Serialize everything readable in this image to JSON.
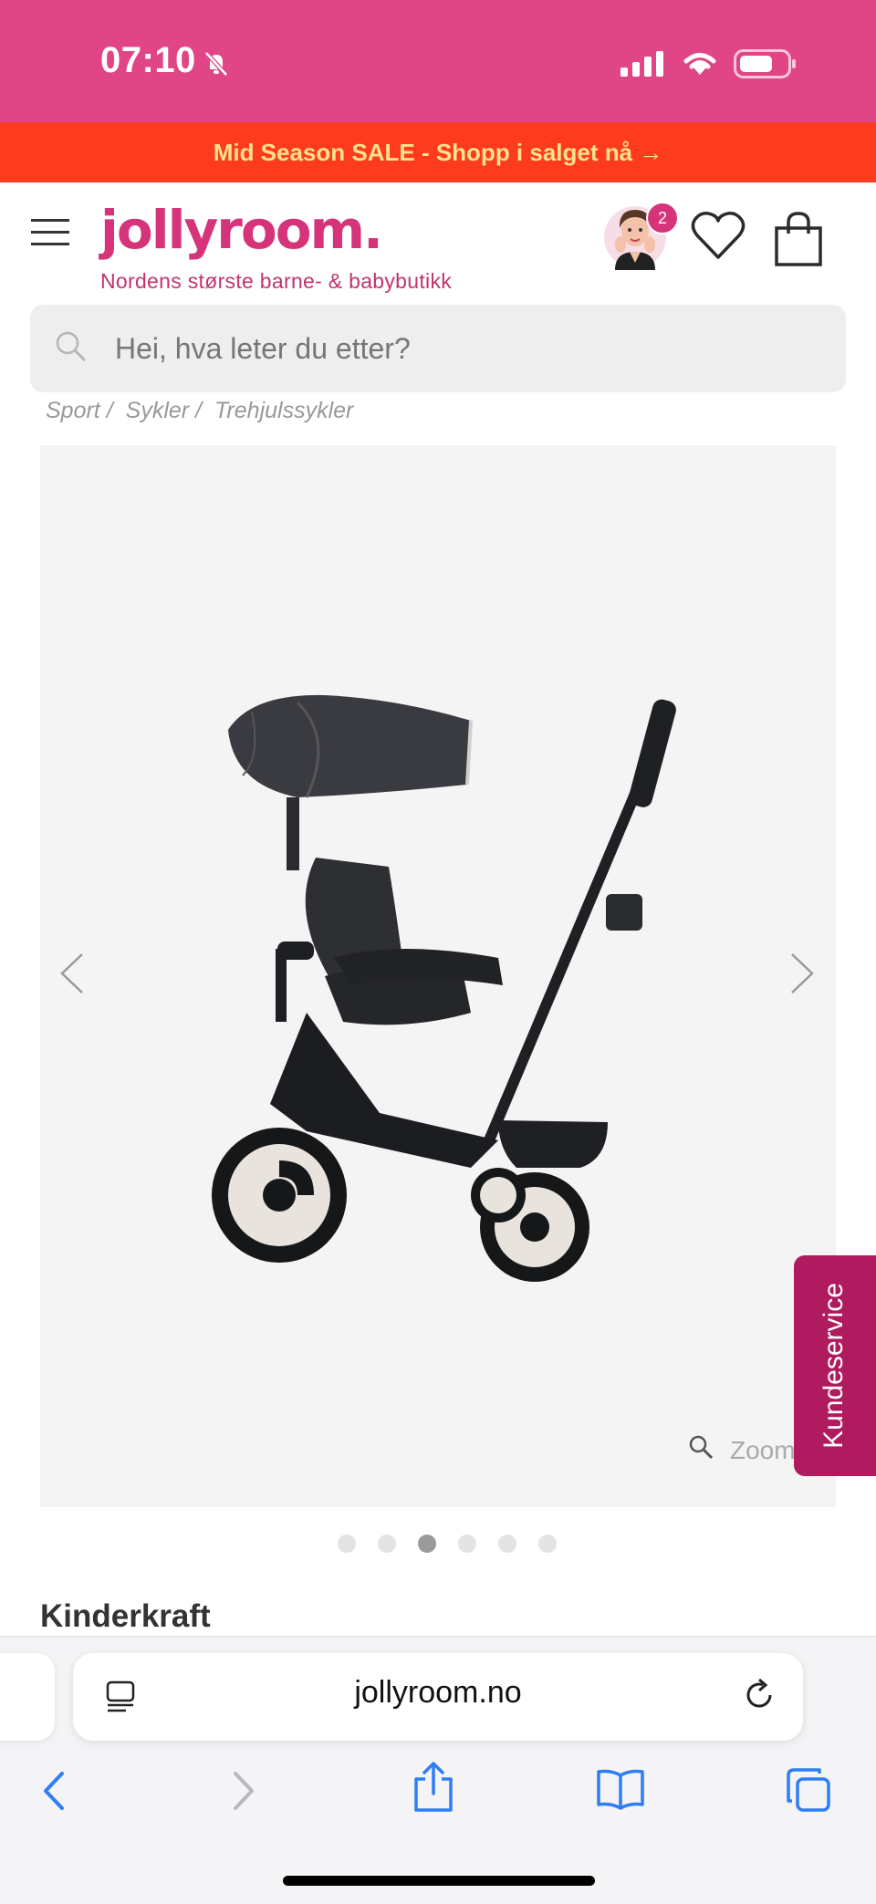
{
  "status_bar": {
    "time": "07:10",
    "background": "#e04585"
  },
  "promo": {
    "text": "Mid Season SALE - Shopp i salget nå →",
    "background": "#ff3b1f",
    "text_color": "#ffe38a"
  },
  "header": {
    "logo": "jollyroom.",
    "tagline": "Nordens største barne- & babybutikk",
    "brand_color": "#d5337a",
    "cart_count": "2",
    "icons": [
      "menu-icon",
      "avatar",
      "heart-icon",
      "bag-icon"
    ]
  },
  "search": {
    "placeholder": "Hei, hva leter du etter?"
  },
  "breadcrumb": {
    "items": [
      "Sport /",
      "Sykler /",
      "Trehjulssykler"
    ]
  },
  "gallery": {
    "zoom_label": "Zoom",
    "total_images": 6,
    "active_index": 3
  },
  "customer_service": {
    "label": "Kundeservice",
    "background": "#b01a5f"
  },
  "product": {
    "brand": "Kinderkraft"
  },
  "browser": {
    "url": "jollyroom.no"
  }
}
